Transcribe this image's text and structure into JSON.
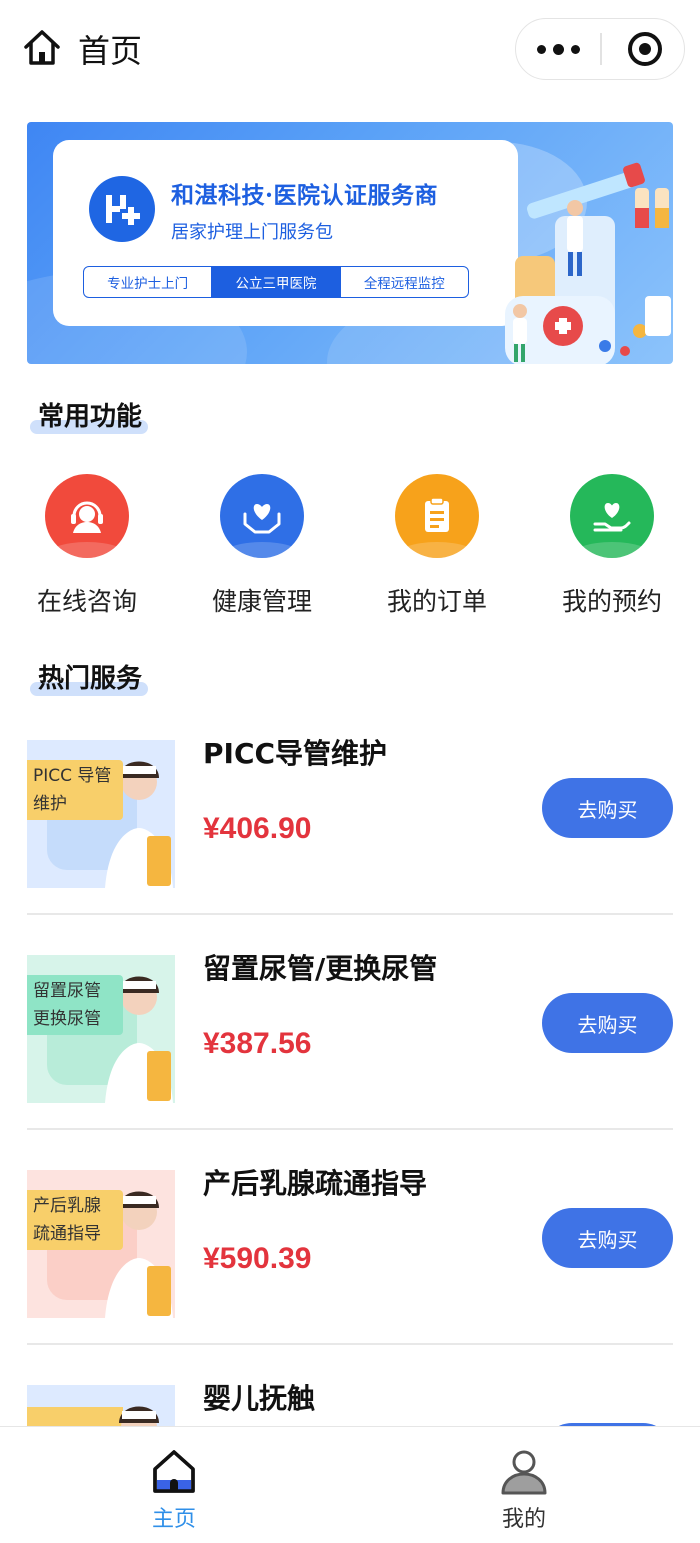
{
  "header": {
    "title": "首页"
  },
  "banner": {
    "headline": "和湛科技·医院认证服务商",
    "subline": "居家护理上门服务包",
    "tags": [
      "专业护士上门",
      "公立三甲医院",
      "全程远程监控"
    ]
  },
  "sections": {
    "functions": "常用功能",
    "services": "热门服务"
  },
  "functions": [
    {
      "label": "在线咨询",
      "color": "#f14a3c",
      "icon": "headset-icon"
    },
    {
      "label": "健康管理",
      "color": "#2f6fe6",
      "icon": "heart-hands-icon"
    },
    {
      "label": "我的订单",
      "color": "#f7a21b",
      "icon": "clipboard-icon"
    },
    {
      "label": "我的预约",
      "color": "#25b85a",
      "icon": "heart-hand-icon"
    }
  ],
  "services": [
    {
      "name": "PICC导管维护",
      "price": "¥406.90",
      "tag": "PICC 导管维护",
      "thumb_color": "#ddeaff",
      "tag_color": "#f8cf6a",
      "buy": "去购买"
    },
    {
      "name": "留置尿管/更换尿管",
      "price": "¥387.56",
      "tag": "留置尿管 更换尿管",
      "thumb_color": "#d7f4ea",
      "tag_color": "#8fe4c6",
      "buy": "去购买"
    },
    {
      "name": "产后乳腺疏通指导",
      "price": "¥590.39",
      "tag": "产后乳腺 疏通指导",
      "thumb_color": "#fde3df",
      "tag_color": "#f8cf6a",
      "buy": "去购买"
    },
    {
      "name": "婴儿抚触",
      "price": "",
      "tag": "",
      "thumb_color": "#ddeaff",
      "tag_color": "#f8cf6a",
      "buy": ""
    }
  ],
  "tabbar": {
    "home": "主页",
    "mine": "我的",
    "active_color": "#2f8fe8"
  }
}
